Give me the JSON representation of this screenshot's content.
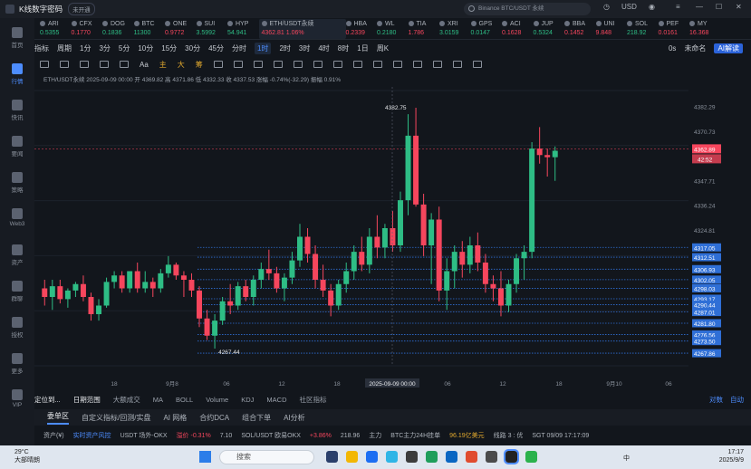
{
  "window": {
    "app_name": "K线数字密码",
    "badge": "未开通",
    "search_placeholder": "Binance BTC/USDT 永续",
    "currency": "USD"
  },
  "sidebar": [
    {
      "label": "首页",
      "active": false
    },
    {
      "label": "行情",
      "active": true
    },
    {
      "label": "快讯",
      "active": false
    },
    {
      "label": "要闻",
      "active": false
    },
    {
      "label": "策略",
      "active": false
    },
    {
      "label": "Web3",
      "active": false
    },
    {
      "label": "资产",
      "active": false
    },
    {
      "label": "群聊",
      "active": false
    },
    {
      "label": "授权",
      "active": false
    },
    {
      "label": "更多",
      "active": false
    },
    {
      "label": "VIP",
      "active": false
    }
  ],
  "tickers": [
    {
      "name": "ARI",
      "price": "0.5355",
      "dir": "up"
    },
    {
      "name": "CFX",
      "price": "0.1770",
      "dir": "down"
    },
    {
      "name": "DOG",
      "price": "0.1836",
      "dir": "up"
    },
    {
      "name": "BTC",
      "price": "11300",
      "dir": "up"
    },
    {
      "name": "ONE",
      "price": "0.9772",
      "dir": "down"
    },
    {
      "name": "SUI",
      "price": "3.5992",
      "dir": "up"
    },
    {
      "name": "HYP",
      "price": "54.941",
      "dir": "up"
    },
    {
      "name": "ETH/USDT永续",
      "price": "4362.81",
      "change": "1.06%",
      "dir": "down",
      "active": true
    },
    {
      "name": "HBA",
      "price": "0.2339",
      "dir": "down"
    },
    {
      "name": "WL",
      "price": "0.2180",
      "dir": "up"
    },
    {
      "name": "TIA",
      "price": "1.786",
      "dir": "down"
    },
    {
      "name": "XRI",
      "price": "3.0159",
      "dir": "up"
    },
    {
      "name": "GPS",
      "price": "0.0147",
      "dir": "up"
    },
    {
      "name": "ACI",
      "price": "0.1628",
      "dir": "down"
    },
    {
      "name": "JUP",
      "price": "0.5324",
      "dir": "up"
    },
    {
      "name": "BBA",
      "price": "0.1452",
      "dir": "down"
    },
    {
      "name": "UNI",
      "price": "9.848",
      "dir": "down"
    },
    {
      "name": "SOL",
      "price": "218.92",
      "dir": "up"
    },
    {
      "name": "PEF",
      "price": "0.0161",
      "dir": "down"
    },
    {
      "name": "MY",
      "price": "16.368",
      "dir": "down"
    }
  ],
  "toolbar": {
    "indicator": "指标",
    "period_label": "周期",
    "periods": [
      "1分",
      "3分",
      "5分",
      "10分",
      "15分",
      "30分",
      "45分",
      "分时",
      "1时",
      "2时",
      "3时",
      "4时",
      "8时",
      "1日",
      "周K"
    ],
    "selected_period": "1时",
    "right_items": [
      "0s",
      "未命名",
      "AI解读"
    ]
  },
  "toolbar2": {
    "labels": [
      "Aa",
      "主",
      "大",
      "筹"
    ]
  },
  "infoline": "ETH/USDT永续 2025-09-09 00:00 开 4369.82 高 4371.86 低 4332.33 收 4337.53 涨幅 -0.74%(-32.29) 振幅 0.91%",
  "chart_data": {
    "type": "candlestick",
    "ylim": [
      4262,
      4390
    ],
    "price_ticks": [
      4382.29,
      4370.73,
      4347.71,
      4336.24,
      4324.81
    ],
    "x_ticks": [
      "18",
      "9月8",
      "06",
      "12",
      "18",
      "2025-09-09 00:00",
      "06",
      "12",
      "18",
      "9月10",
      "06"
    ],
    "high_label": "4382.75",
    "low_label": "4267.44",
    "current_price": "4362.89",
    "countdown": "42:52",
    "levels": [
      {
        "value": 4317.05,
        "label": "4317.05"
      },
      {
        "value": 4312.51,
        "label": "4312.51"
      },
      {
        "value": 4306.93,
        "label": "4306.93"
      },
      {
        "value": 4302.05,
        "label": "4302.05"
      },
      {
        "value": 4298.03,
        "label": "4298.03"
      },
      {
        "value": 4293.17,
        "label": "4293.17"
      },
      {
        "value": 4290.44,
        "label": "4290.44"
      },
      {
        "value": 4287.01,
        "label": "4287.01"
      },
      {
        "value": 4281.8,
        "label": "4281.80"
      },
      {
        "value": 4276.56,
        "label": "4276.56"
      },
      {
        "value": 4273.5,
        "label": "4273.50"
      },
      {
        "value": 4267.86,
        "label": "4267.86"
      }
    ],
    "candles": [
      [
        4298,
        4302,
        4290,
        4294
      ],
      [
        4294,
        4302,
        4288,
        4299
      ],
      [
        4299,
        4302,
        4291,
        4293
      ],
      [
        4293,
        4298,
        4289,
        4297
      ],
      [
        4297,
        4301,
        4294,
        4300
      ],
      [
        4300,
        4304,
        4292,
        4294
      ],
      [
        4294,
        4296,
        4283,
        4286
      ],
      [
        4286,
        4293,
        4283,
        4290
      ],
      [
        4290,
        4303,
        4289,
        4301
      ],
      [
        4301,
        4306,
        4298,
        4304
      ],
      [
        4304,
        4306,
        4296,
        4298
      ],
      [
        4298,
        4306,
        4296,
        4306
      ],
      [
        4306,
        4310,
        4296,
        4298
      ],
      [
        4298,
        4306,
        4296,
        4301
      ],
      [
        4301,
        4303,
        4294,
        4298
      ],
      [
        4298,
        4307,
        4296,
        4305
      ],
      [
        4305,
        4313,
        4303,
        4309
      ],
      [
        4309,
        4310,
        4302,
        4304
      ],
      [
        4304,
        4306,
        4294,
        4302
      ],
      [
        4302,
        4305,
        4294,
        4297
      ],
      [
        4297,
        4299,
        4280,
        4284
      ],
      [
        4284,
        4288,
        4274,
        4276
      ],
      [
        4276,
        4286,
        4270,
        4283
      ],
      [
        4283,
        4294,
        4281,
        4292
      ],
      [
        4292,
        4300,
        4286,
        4290
      ],
      [
        4290,
        4301,
        4288,
        4299
      ],
      [
        4299,
        4302,
        4292,
        4294
      ],
      [
        4294,
        4304,
        4290,
        4302
      ],
      [
        4302,
        4310,
        4298,
        4307
      ],
      [
        4307,
        4316,
        4302,
        4305
      ],
      [
        4305,
        4308,
        4296,
        4298
      ],
      [
        4298,
        4305,
        4292,
        4303
      ],
      [
        4303,
        4315,
        4300,
        4311
      ],
      [
        4311,
        4328,
        4308,
        4322
      ],
      [
        4322,
        4326,
        4310,
        4314
      ],
      [
        4314,
        4318,
        4298,
        4302
      ],
      [
        4302,
        4309,
        4294,
        4297
      ],
      [
        4297,
        4300,
        4285,
        4290
      ],
      [
        4290,
        4302,
        4288,
        4300
      ],
      [
        4300,
        4310,
        4296,
        4306
      ],
      [
        4306,
        4318,
        4302,
        4315
      ],
      [
        4315,
        4322,
        4306,
        4309
      ],
      [
        4309,
        4326,
        4305,
        4322
      ],
      [
        4322,
        4332,
        4312,
        4317
      ],
      [
        4317,
        4328,
        4312,
        4326
      ],
      [
        4326,
        4334,
        4315,
        4318
      ],
      [
        4318,
        4343,
        4315,
        4339
      ],
      [
        4339,
        4379,
        4332,
        4369
      ],
      [
        4369,
        4382,
        4336,
        4337
      ],
      [
        4337,
        4342,
        4313,
        4318
      ],
      [
        4318,
        4333,
        4300,
        4330
      ],
      [
        4330,
        4336,
        4292,
        4297
      ],
      [
        4297,
        4312,
        4288,
        4306
      ],
      [
        4306,
        4318,
        4298,
        4315
      ],
      [
        4315,
        4320,
        4303,
        4309
      ],
      [
        4309,
        4322,
        4305,
        4318
      ],
      [
        4318,
        4324,
        4306,
        4310
      ],
      [
        4310,
        4314,
        4296,
        4300
      ],
      [
        4300,
        4304,
        4292,
        4298
      ],
      [
        4298,
        4306,
        4285,
        4290
      ],
      [
        4290,
        4302,
        4287,
        4300
      ],
      [
        4300,
        4314,
        4296,
        4312
      ],
      [
        4312,
        4318,
        4302,
        4315
      ],
      [
        4315,
        4366,
        4312,
        4363
      ],
      [
        4363,
        4373,
        4356,
        4360
      ],
      [
        4360,
        4363,
        4350,
        4359
      ],
      [
        4359,
        4364,
        4348,
        4362
      ]
    ]
  },
  "bottomtabs": {
    "left": [
      "定位到...",
      "日期范围"
    ],
    "indicators": [
      "大额成交",
      "MA",
      "BOLL",
      "Volume",
      "KDJ",
      "MACD",
      "社区指标"
    ],
    "right": [
      "对数",
      "自动"
    ]
  },
  "panelbar": [
    "委单区",
    "自定义指标/回测/实盘",
    "AI 网格",
    "合约DCA",
    "组合下单",
    "AI分析"
  ],
  "statusbar": [
    {
      "text": "资产(¥)"
    },
    {
      "text": "实时资产风控",
      "color": "#4d8dff"
    },
    {
      "text": "USDT 场外-OKX"
    },
    {
      "text": "溢价 -0.31%",
      "color": "#f6465d"
    },
    {
      "text": "7.10"
    },
    {
      "text": "SOL/USDT 欧易OKX"
    },
    {
      "text": "+3.86%",
      "color": "#f6465d"
    },
    {
      "text": "218.96"
    },
    {
      "text": "主力"
    },
    {
      "text": "BTC主力24H挂单"
    },
    {
      "text": "96.19亿美元",
      "color": "#e0a82e"
    },
    {
      "text": "线路 3 : 优"
    },
    {
      "text": "SGT 09/09 17:17:09"
    }
  ],
  "taskbar": {
    "temp": "29°C",
    "weather": "大部晴朗",
    "search": "搜索",
    "time": "17:17",
    "date": "2025/9/9",
    "lang": "中"
  }
}
